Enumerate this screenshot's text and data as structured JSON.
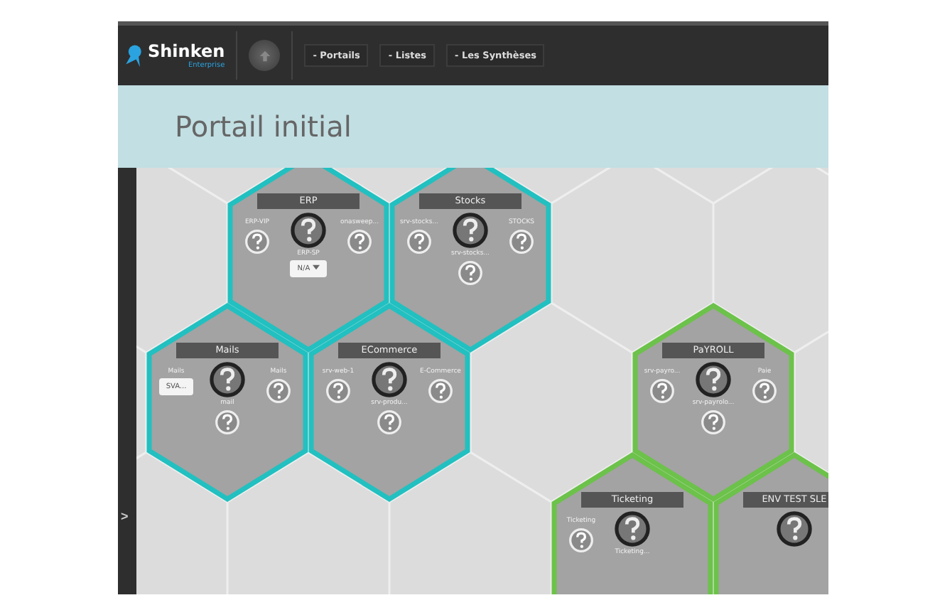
{
  "header": {
    "logo": {
      "name": "Shinken",
      "subtitle": "Enterprise"
    },
    "nav": [
      "- Portails",
      "- Listes",
      "- Les Synthèses"
    ]
  },
  "page_title": "Portail initial",
  "sidebar": {
    "toggle": ">"
  },
  "tiles": [
    {
      "title": "ERP",
      "color": "#22c0c0",
      "left": {
        "kind": "service",
        "label": "ERP-VIP"
      },
      "right": {
        "kind": "service",
        "label": "onasweep..."
      },
      "center_label": "ERP-SP",
      "bottom": {
        "kind": "select",
        "value": "N/A"
      }
    },
    {
      "title": "Stocks",
      "color": "#22c0c0",
      "left": {
        "kind": "service",
        "label": "srv-stocks..."
      },
      "right": {
        "kind": "service",
        "label": "STOCKS"
      },
      "center_label": "srv-stocks...",
      "bottom": {
        "kind": "service"
      }
    },
    {
      "title": "Mails",
      "color": "#22c0c0",
      "left": {
        "kind": "select",
        "label": "Mails",
        "value": "SVA..."
      },
      "right": {
        "kind": "service",
        "label": "Mails"
      },
      "center_label": "mail",
      "bottom": {
        "kind": "service"
      }
    },
    {
      "title": "ECommerce",
      "color": "#22c0c0",
      "left": {
        "kind": "service",
        "label": "srv-web-1"
      },
      "right": {
        "kind": "service",
        "label": "E-Commerce"
      },
      "center_label": "srv-produ...",
      "bottom": {
        "kind": "service"
      }
    },
    {
      "title": "PaYROLL",
      "color": "#6cc24a",
      "left": {
        "kind": "service",
        "label": "srv-payro..."
      },
      "right": {
        "kind": "service",
        "label": "Paie"
      },
      "center_label": "srv-payrolo...",
      "bottom": {
        "kind": "service"
      }
    },
    {
      "title": "Ticketing",
      "color": "#6cc24a",
      "left": {
        "kind": "service",
        "label": "Ticketing"
      },
      "center_label": "Ticketing..."
    },
    {
      "title": "ENV TEST SLE",
      "color": "#6cc24a"
    }
  ]
}
